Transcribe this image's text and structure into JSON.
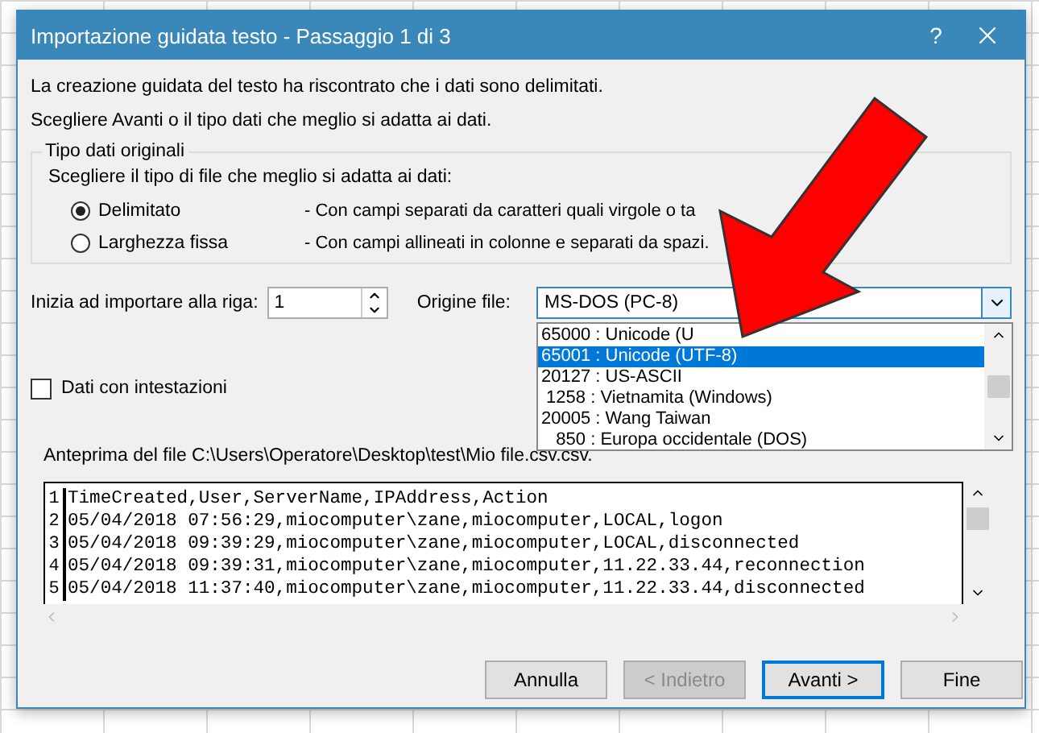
{
  "window": {
    "title": "Importazione guidata testo - Passaggio 1 di 3",
    "help": "?"
  },
  "intro": [
    "La creazione guidata del testo ha riscontrato che i dati sono delimitati.",
    "Scegliere Avanti o il tipo dati che meglio si adatta ai dati."
  ],
  "group": {
    "legend": "Tipo dati originali",
    "prompt": "Scegliere il tipo di file che meglio si adatta ai dati:",
    "options": [
      {
        "label": "Delimitato",
        "description": "- Con campi separati da caratteri quali virgole o ta",
        "selected": true
      },
      {
        "label": "Larghezza fissa",
        "description": "- Con campi allineati in colonne e separati da spazi.",
        "selected": false
      }
    ]
  },
  "start_row": {
    "label": "Inizia ad importare alla riga:",
    "value": "1"
  },
  "origin": {
    "label": "Origine file:",
    "value": "MS-DOS (PC-8)",
    "list": [
      {
        "label": "65000 : Unicode (U",
        "selected": false
      },
      {
        "label": "65001 : Unicode (UTF-8)",
        "selected": true
      },
      {
        "label": "20127 : US-ASCII",
        "selected": false
      },
      {
        "label": " 1258 : Vietnamita (Windows)",
        "selected": false
      },
      {
        "label": "20005 : Wang Taiwan",
        "selected": false
      },
      {
        "label": "   850 : Europa occidentale (DOS)",
        "selected": false
      }
    ]
  },
  "headers": {
    "label": "Dati con intestazioni",
    "checked": false
  },
  "preview": {
    "label": "Anteprima del file C:\\Users\\Operatore\\Desktop\\test\\Mio file.csv.csv.",
    "rows": [
      {
        "number": "1",
        "text": "TimeCreated,User,ServerName,IPAddress,Action"
      },
      {
        "number": "2",
        "text": "05/04/2018 07:56:29,miocomputer\\zane,miocomputer,LOCAL,logon"
      },
      {
        "number": "3",
        "text": "05/04/2018 09:39:29,miocomputer\\zane,miocomputer,LOCAL,disconnected"
      },
      {
        "number": "4",
        "text": "05/04/2018 09:39:31,miocomputer\\zane,miocomputer,11.22.33.44,reconnection"
      },
      {
        "number": "5",
        "text": "05/04/2018 11:37:40,miocomputer\\zane,miocomputer,11.22.33.44,disconnected"
      }
    ]
  },
  "buttons": [
    {
      "label": "Annulla",
      "disabled": false,
      "default": false
    },
    {
      "label": "< Indietro",
      "disabled": true,
      "default": false
    },
    {
      "label": "Avanti >",
      "disabled": false,
      "default": true
    },
    {
      "label": "Fine",
      "disabled": false,
      "default": false
    }
  ]
}
